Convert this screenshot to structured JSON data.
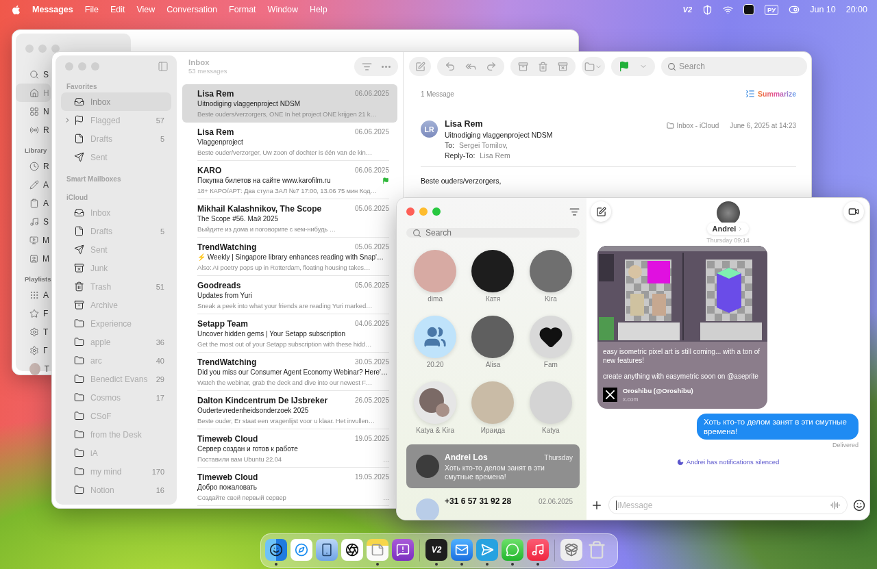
{
  "menu_bar": {
    "app_name": "Messages",
    "menus": [
      "File",
      "Edit",
      "View",
      "Conversation",
      "Format",
      "Window",
      "Help"
    ],
    "vpn_label": "V2",
    "input_source": "РУ",
    "date": "Jun 10",
    "time": "20:00"
  },
  "music_window": {
    "sidebar": [
      {
        "items": [
          {
            "label": "S",
            "selected": false
          },
          {
            "label": "H",
            "selected": true
          },
          {
            "label": "N",
            "selected": false
          },
          {
            "label": "R",
            "selected": false
          }
        ]
      },
      {
        "title": "Library",
        "items": [
          {
            "label": "R",
            "selected": false
          },
          {
            "label": "A",
            "selected": false
          },
          {
            "label": "A",
            "selected": false
          },
          {
            "label": "S",
            "selected": false
          },
          {
            "label": "M",
            "selected": false
          },
          {
            "label": "M",
            "selected": false
          }
        ]
      },
      {
        "title": "Playlists",
        "items": [
          {
            "label": "A",
            "selected": false
          },
          {
            "label": "F",
            "selected": false
          },
          {
            "label": "T",
            "selected": false
          },
          {
            "label": "Г",
            "selected": false
          },
          {
            "label": "T",
            "selected": false
          }
        ]
      }
    ]
  },
  "mail_window": {
    "sidebar": [
      {
        "title": "Favorites",
        "items": [
          {
            "label": "Inbox",
            "selected": true
          },
          {
            "label": "Flagged",
            "count": "57",
            "expanded": false,
            "selected": false
          },
          {
            "label": "Drafts",
            "count": "5",
            "selected": false
          },
          {
            "label": "Sent",
            "selected": false
          }
        ]
      },
      {
        "title": "Smart Mailboxes"
      },
      {
        "title": "iCloud",
        "items": [
          {
            "label": "Inbox",
            "selected": false
          },
          {
            "label": "Drafts",
            "count": "5",
            "selected": false
          },
          {
            "label": "Sent",
            "selected": false
          },
          {
            "label": "Junk",
            "selected": false
          },
          {
            "label": "Trash",
            "count": "51",
            "selected": false
          },
          {
            "label": "Archive",
            "selected": false
          },
          {
            "label": "Experience",
            "selected": false
          },
          {
            "label": "apple",
            "count": "36",
            "selected": false
          },
          {
            "label": "arc",
            "count": "40",
            "selected": false
          },
          {
            "label": "Benedict Evans",
            "count": "29",
            "selected": false
          },
          {
            "label": "Cosmos",
            "count": "17",
            "selected": false
          },
          {
            "label": "CSoF",
            "selected": false
          },
          {
            "label": "from the Desk",
            "selected": false
          },
          {
            "label": "iA",
            "selected": false
          },
          {
            "label": "my mind",
            "count": "170",
            "selected": false
          },
          {
            "label": "Notion",
            "count": "16",
            "selected": false
          }
        ]
      }
    ],
    "list": {
      "title": "Inbox",
      "count": "53 messages",
      "messages": [
        {
          "sender": "Lisa Rem",
          "date": "06.06.2025",
          "subject": "Uitnodiging vlaggenproject NDSM",
          "preview": "Beste ouders/verzorgers, ONE In het project ONE krijgen 21 k…",
          "selected": true,
          "flagged": false
        },
        {
          "sender": "Lisa Rem",
          "date": "06.06.2025",
          "subject": "Vlaggenproject",
          "preview": "Beste ouder/verzorger, Uw zoon of dochter is één van de kin…",
          "selected": false,
          "flagged": false
        },
        {
          "sender": "KARO",
          "date": "06.06.2025",
          "subject": "Покупка билетов на сайте www.karofilm.ru",
          "preview": "18+ КАРО/АРТ: Два стула ЗАЛ №7 17:00, 13.06 75 мин Код…",
          "selected": false,
          "flagged": true
        },
        {
          "sender": "Mikhail Kalashnikov, The Scope",
          "date": "05.06.2025",
          "subject": "The Scope #56. Май 2025",
          "preview": "Выйдите из дома и поговорите с кем-нибудь …",
          "selected": false,
          "flagged": false
        },
        {
          "sender": "TrendWatching",
          "date": "05.06.2025",
          "subject": "⚡ Weekly | Singapore library enhances reading with Snap'…",
          "preview": "Also: AI poetry pops up in Rotterdam, floating housing takes…",
          "selected": false,
          "flagged": false
        },
        {
          "sender": "Goodreads",
          "date": "05.06.2025",
          "subject": "Updates from Yuri",
          "preview": "Sneak a peek into what your friends are reading Yuri marked…",
          "selected": false,
          "flagged": false
        },
        {
          "sender": "Setapp Team",
          "date": "04.06.2025",
          "subject": "Uncover hidden gems | Your Setapp subscription",
          "preview": "Get the most out of your Setapp subscription with these hidd…",
          "selected": false,
          "flagged": false
        },
        {
          "sender": "TrendWatching",
          "date": "30.05.2025",
          "subject": "Did you miss our Consumer Agent Economy Webinar? Here'…",
          "preview": "Watch the webinar, grab the deck and dive into our newest F…",
          "selected": false,
          "flagged": false
        },
        {
          "sender": "Dalton Kindcentrum De IJsbreker",
          "date": "26.05.2025",
          "subject": "Oudertevredenheidsonderzoek 2025",
          "preview": "Beste ouder, Er staat een vragenlijst voor u klaar. Het invullen…",
          "selected": false,
          "flagged": false
        },
        {
          "sender": "Timeweb Cloud",
          "date": "19.05.2025",
          "subject": "Сервер создан и готов к работе",
          "preview": "Поставили вам Ubuntu 22.04",
          "trailing": "…",
          "selected": false,
          "flagged": false
        },
        {
          "sender": "Timeweb Cloud",
          "date": "19.05.2025",
          "subject": "Добро пожаловать",
          "preview": "Создайте свой первый сервер",
          "trailing": "…",
          "selected": false,
          "flagged": false
        }
      ]
    },
    "reader": {
      "search_placeholder": "Search",
      "message_count": "1 Message",
      "summarize": "Summarize",
      "initials": "LR",
      "sender": "Lisa Rem",
      "subject": "Uitnodiging vlaggenproject NDSM",
      "to_label": "To:",
      "to": "Sergei Tomilov,",
      "reply_to_label": "Reply-To:",
      "reply_to": "Lisa Rem",
      "mailbox": "Inbox - iCloud",
      "date": "June 6, 2025 at 14:23",
      "body": "Beste ouders/verzorgers,"
    }
  },
  "messages_window": {
    "search_placeholder": "Search",
    "pinned": [
      {
        "name": "dima",
        "kind": "photo"
      },
      {
        "name": "Катя",
        "kind": "photo"
      },
      {
        "name": "Kira",
        "kind": "photo"
      },
      {
        "name": "20.20",
        "kind": "group"
      },
      {
        "name": "Alisa",
        "kind": "photo"
      },
      {
        "name": "Fam",
        "kind": "heart"
      },
      {
        "name": "Katya & Kira",
        "kind": "duo"
      },
      {
        "name": "Ираида",
        "kind": "photo"
      },
      {
        "name": "Katya",
        "kind": "photo"
      }
    ],
    "conversations": [
      {
        "name": "Andrei Los",
        "date": "Thursday",
        "preview": "Хоть кто-то делом занят в эти смутные времена!",
        "selected": true
      },
      {
        "name": "+31 6 57 31 92 28",
        "date": "02.06.2025",
        "selected": false
      }
    ],
    "chat": {
      "contact": "Andrei",
      "timestamp": "Thursday 09:14",
      "messages": [
        {
          "kind": "link",
          "paragraphs": [
            "easy isometric pixel art is still coming... with a ton of new features!",
            "create anything with easymetric soon on @aseprite"
          ],
          "source_title": "Oroshibu (@Oroshibu)",
          "source_domain": "x.com"
        },
        {
          "kind": "sent",
          "text": "Хоть кто-то делом занят в эти смутные времена!",
          "status": "Delivered"
        }
      ],
      "notice": "Andrei has notifications silenced",
      "input_placeholder": "iMessage"
    }
  },
  "dock": {
    "items": [
      {
        "running": true
      },
      {
        "running": false
      },
      {
        "running": false
      },
      {
        "running": false
      },
      {
        "running": true
      },
      {
        "running": false
      },
      {
        "label": "V2",
        "running": true
      },
      {
        "running": true
      },
      {
        "running": true
      },
      {
        "running": true
      },
      {
        "running": true
      },
      {
        "running": false
      },
      {
        "running": false
      }
    ]
  }
}
